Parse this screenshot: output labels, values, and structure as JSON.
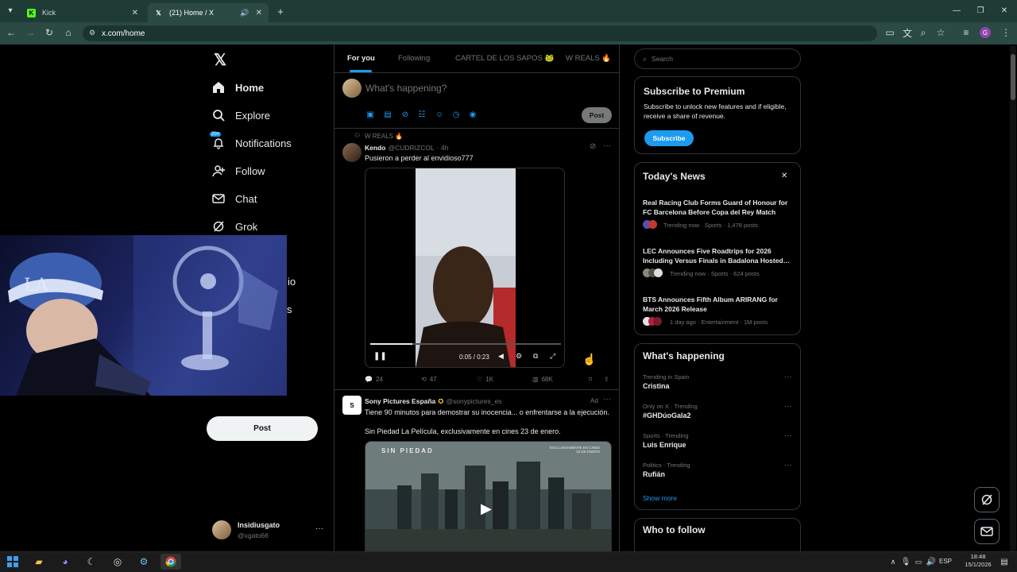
{
  "browser": {
    "tabs": [
      {
        "title": "Kick",
        "icon": "kick-icon",
        "color": "#53fc18"
      },
      {
        "title": "(21) Home / X",
        "icon": "x-icon",
        "color": "#ffffff"
      }
    ],
    "url": "x.com/home",
    "profile_letter": "G"
  },
  "sidebar": {
    "items": [
      {
        "label": "Home",
        "icon": "home-icon"
      },
      {
        "label": "Explore",
        "icon": "search-icon"
      },
      {
        "label": "Notifications",
        "icon": "bell-icon",
        "badge": "20+"
      },
      {
        "label": "Follow",
        "icon": "follow-icon"
      },
      {
        "label": "Chat",
        "icon": "mail-icon"
      },
      {
        "label": "Grok",
        "icon": "grok-icon"
      }
    ],
    "partial_labels": [
      "io",
      "s"
    ],
    "post_label": "Post",
    "account": {
      "name": "Insidiusgato",
      "handle": "@xgato66",
      "more": "···"
    }
  },
  "feed": {
    "tabs": [
      "For you",
      "Following",
      "CARTEL DE LOS SAPOS 🐸",
      "W REALS 🔥"
    ],
    "composer": {
      "placeholder": "What's happening?",
      "post_label": "Post"
    },
    "tweet1": {
      "context": "W REALS 🔥",
      "author": "Kendo",
      "handle": "@CUDRIZCOL",
      "time": "· 4h",
      "text": "Pusieron a perder al envidioso777",
      "video_time": "0:05 / 0:23",
      "replies": "24",
      "reposts": "47",
      "likes": "1K",
      "views": "68K",
      "more": "···"
    },
    "tweet2": {
      "author": "Sony Pictures España",
      "handle": "@sonypictures_es",
      "ad_label": "Ad",
      "more": "···",
      "text1": "Tiene 90 minutos para demostrar su inocencia... o enfrentarse a la ejecución.",
      "text2": "Sin Piedad La Película, exclusivamente en cines 23 de enero.",
      "poster_title": "SIN PIEDAD",
      "poster_sub": "EXCLUSIVAMENTE EN CINES\n23 DE ENERO"
    }
  },
  "right": {
    "search_placeholder": "Search",
    "premium": {
      "title": "Subscribe to Premium",
      "text": "Subscribe to unlock new features and if eligible, receive a share of revenue.",
      "button": "Subscribe"
    },
    "news": {
      "title": "Today's News",
      "close": "✕",
      "items": [
        {
          "headline": "Real Racing Club Forms Guard of Honour for FC Barcelona Before Copa del Rey Match",
          "meta": "Trending now · Sports · 1,478 posts"
        },
        {
          "headline": "LEC Announces Five Roadtrips for 2026 Including Versus Finals in Badalona Hosted…",
          "meta": "Trending now · Sports · 624 posts"
        },
        {
          "headline": "BTS Announces Fifth Album ARIRANG for March 2026 Release",
          "meta": "1 day ago · Entertainment · 1M posts"
        }
      ]
    },
    "happening": {
      "title": "What's happening",
      "items": [
        {
          "context": "Trending in Spain",
          "name": "Cristina"
        },
        {
          "context": "Only on X · Trending",
          "name": "#GHDúoGala2"
        },
        {
          "context": "Sports · Trending",
          "name": "Luis Enrique"
        },
        {
          "context": "Politics · Trending",
          "name": "Rufián"
        }
      ],
      "show_more": "Show more"
    },
    "who_to_follow": {
      "title": "Who to follow"
    }
  },
  "taskbar": {
    "language": "ESP",
    "time": "18:48",
    "date": "15/1/2026"
  },
  "colors": {
    "accent": "#1d9bf0",
    "background": "#000000",
    "border": "#2f3336",
    "chrome_tab": "#1f3b35",
    "chrome_toolbar": "#2b4a43"
  }
}
